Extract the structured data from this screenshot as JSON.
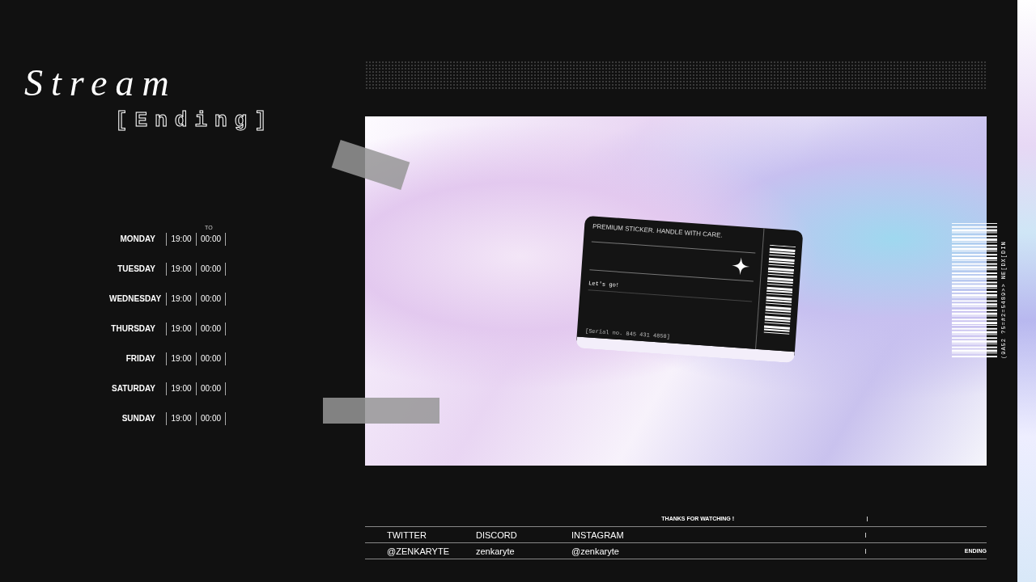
{
  "title": {
    "script": "Stream",
    "pixel": "[Ending]"
  },
  "schedule": {
    "header": "TO",
    "rows": [
      {
        "day": "MONDAY",
        "start": "19:00",
        "end": "00:00"
      },
      {
        "day": "TUESDAY",
        "start": "19:00",
        "end": "00:00"
      },
      {
        "day": "WEDNESDAY",
        "start": "19:00",
        "end": "00:00"
      },
      {
        "day": "THURSDAY",
        "start": "19:00",
        "end": "00:00"
      },
      {
        "day": "FRIDAY",
        "start": "19:00",
        "end": "00:00"
      },
      {
        "day": "SATURDAY",
        "start": "19:00",
        "end": "00:00"
      },
      {
        "day": "SUNDAY",
        "start": "19:00",
        "end": "00:00"
      }
    ]
  },
  "card": {
    "heading": "PREMIUM STICKER. HANDLE WITH CARE.",
    "message": "Let's go!",
    "serial": "[Serial no. 845 431 4850]"
  },
  "side_code": "(9A52 ?5=#2=5489>> NE[DX[DIN",
  "footer": {
    "banner": "THANKS FOR WATCHING !",
    "platforms": [
      "TWITTER",
      "DISCORD",
      "INSTAGRAM"
    ],
    "handles": [
      "@ZENKARYTE",
      "zenkaryte",
      "@zenkaryte"
    ],
    "tag": "ENDING"
  }
}
